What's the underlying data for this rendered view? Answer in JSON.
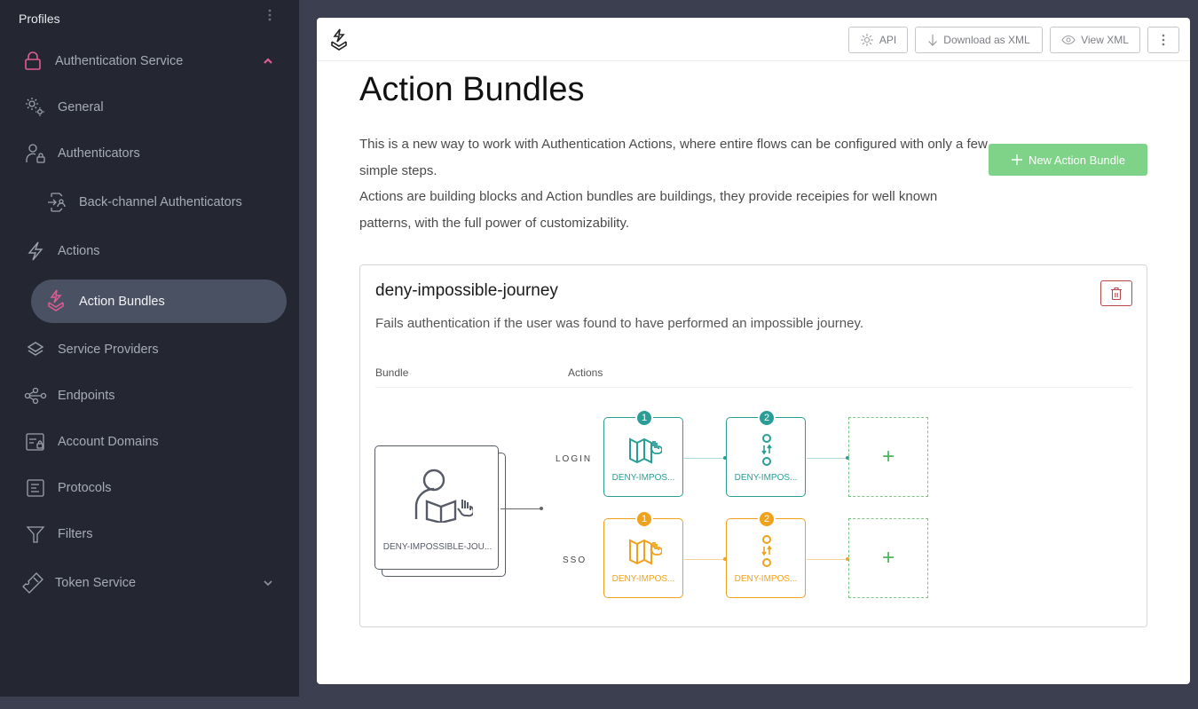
{
  "sidebar": {
    "header": "Profiles",
    "sections": [
      {
        "label": "Authentication Service",
        "icon": "lock-icon",
        "expanded": true,
        "accent": "#e05c92"
      },
      {
        "label": "Token Service",
        "icon": "ticket-icon",
        "expanded": false
      }
    ],
    "items": [
      {
        "label": "General",
        "icon": "gears-icon"
      },
      {
        "label": "Authenticators",
        "icon": "user-lock-icon"
      },
      {
        "label": "Back-channel Authenticators",
        "icon": "backchannel-icon"
      },
      {
        "label": "Actions",
        "icon": "lightning-icon"
      },
      {
        "label": "Action Bundles",
        "icon": "action-bundle-icon",
        "active": true
      },
      {
        "label": "Service Providers",
        "icon": "layers-icon"
      },
      {
        "label": "Endpoints",
        "icon": "share-nodes-icon"
      },
      {
        "label": "Account Domains",
        "icon": "account-domain-icon"
      },
      {
        "label": "Protocols",
        "icon": "document-icon"
      },
      {
        "label": "Filters",
        "icon": "filter-icon"
      }
    ]
  },
  "toolbar": {
    "api_label": "API",
    "download_label": "Download as XML",
    "view_label": "View XML"
  },
  "page": {
    "title": "Action Bundles",
    "intro_line1": "This is a new way to work with Authentication Actions, where entire flows can be configured with only a few simple steps.",
    "intro_line2": "Actions are building blocks and Action bundles are buildings, they provide receipies for well known patterns, with the full power of customizability.",
    "new_button": "New Action Bundle"
  },
  "bundle": {
    "title": "deny-impossible-journey",
    "description": "Fails authentication if the user was found to have performed an impossible journey.",
    "col_bundle": "Bundle",
    "col_actions": "Actions",
    "bundle_name": "DENY-IMPOSSIBLE-JOU...",
    "flows": [
      {
        "label": "LOGIN",
        "color": "#2a9d96",
        "actions": [
          {
            "step": "1",
            "name": "DENY-IMPOS...",
            "icon": "map-hand-icon"
          },
          {
            "step": "2",
            "name": "DENY-IMPOS...",
            "icon": "switch-icon"
          }
        ]
      },
      {
        "label": "SSO",
        "color": "#f0a21c",
        "actions": [
          {
            "step": "1",
            "name": "DENY-IMPOS...",
            "icon": "map-hand-icon"
          },
          {
            "step": "2",
            "name": "DENY-IMPOS...",
            "icon": "switch-icon"
          }
        ]
      }
    ],
    "add_label": "+"
  },
  "colors": {
    "accent": "#e05c92",
    "login": "#2a9d96",
    "sso": "#f0a21c",
    "add": "#4cb55a",
    "danger": "#b9474a",
    "primary_button": "#7ed388"
  }
}
